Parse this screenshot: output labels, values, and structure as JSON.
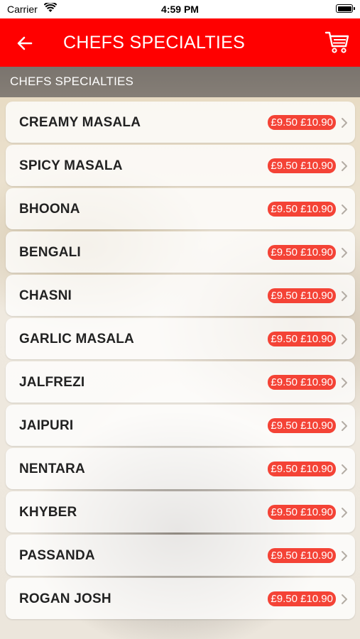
{
  "status": {
    "carrier": "Carrier",
    "time": "4:59 PM"
  },
  "navbar": {
    "title": "CHEFS SPECIALTIES",
    "back_icon": "arrow-left-icon",
    "cart_icon": "cart-icon"
  },
  "section": {
    "title": "CHEFS SPECIALTIES"
  },
  "items": [
    {
      "name": "CREAMY MASALA",
      "price": "£9.50 £10.90"
    },
    {
      "name": "SPICY MASALA",
      "price": "£9.50 £10.90"
    },
    {
      "name": "BHOONA",
      "price": "£9.50 £10.90"
    },
    {
      "name": "BENGALI",
      "price": "£9.50 £10.90"
    },
    {
      "name": "CHASNI",
      "price": "£9.50 £10.90"
    },
    {
      "name": "GARLIC MASALA",
      "price": "£9.50 £10.90"
    },
    {
      "name": "JALFREZI",
      "price": "£9.50 £10.90"
    },
    {
      "name": "JAIPURI",
      "price": "£9.50 £10.90"
    },
    {
      "name": "NENTARA",
      "price": "£9.50 £10.90"
    },
    {
      "name": "KHYBER",
      "price": "£9.50 £10.90"
    },
    {
      "name": "PASSANDA",
      "price": "£9.50 £10.90"
    },
    {
      "name": "ROGAN JOSH",
      "price": "£9.50 £10.90"
    }
  ],
  "colors": {
    "accent": "#ff0000",
    "price_badge": "#f44336",
    "section_bar": "#7f7871"
  }
}
